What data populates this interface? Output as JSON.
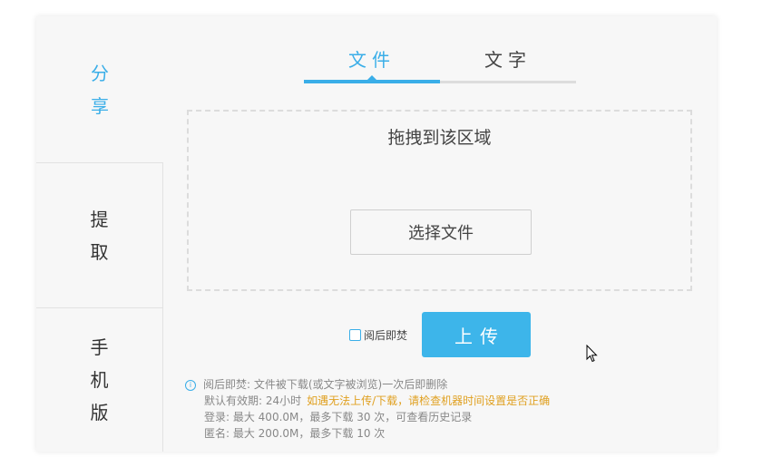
{
  "sidebar": {
    "share": [
      "分",
      "享"
    ],
    "fetch": [
      "提",
      "取"
    ],
    "mobile": [
      "手",
      "机",
      "版"
    ]
  },
  "tabs": {
    "file": "文件",
    "text": "文字"
  },
  "dropzone": {
    "title": "拖拽到该区域",
    "choose_label": "选择文件"
  },
  "burn_after_read": {
    "label": "阅后即焚",
    "checked": false
  },
  "upload_label": "上传",
  "notes": {
    "line1": "阅后即焚: 文件被下载(或文字被浏览)一次后即删除",
    "line2": "默认有效期: 24小时",
    "line2_warning": "如遇无法上传/下载，请检查机器时间设置是否正确",
    "line3": "登录: 最大 400.0M，最多下载 30 次，可查看历史记录",
    "line4": "匿名: 最大 200.0M，最多下载 10 次"
  },
  "colors": {
    "accent": "#3aaee8",
    "warning": "#e0a020",
    "panel_bg": "#f7f7f7"
  },
  "icons": {
    "info": "info-icon",
    "cursor": "mouse-cursor-icon"
  }
}
